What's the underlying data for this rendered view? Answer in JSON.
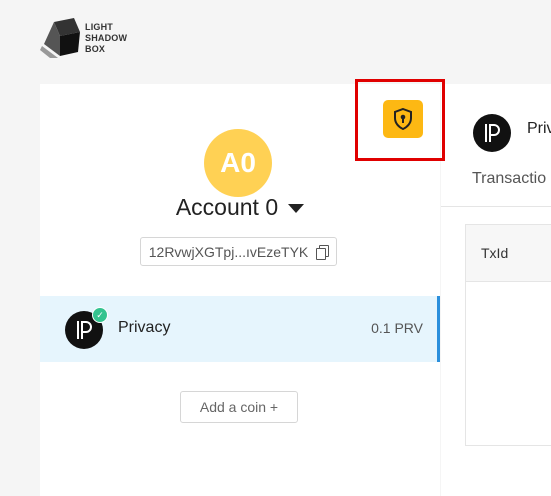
{
  "logo": {
    "line1": "LIGHT",
    "line2": "SHADOW",
    "line3": "BOX"
  },
  "account": {
    "avatar_initials": "A0",
    "name": "Account 0",
    "address": "12RvwjXGTpj...ıvEzeTYK"
  },
  "coins": [
    {
      "icon_text": "P",
      "name": "Privacy",
      "balance": "0.1 PRV",
      "selected": true
    }
  ],
  "add_coin_label": "Add a coin +",
  "right_panel": {
    "title": "Priv",
    "subtitle": "Transactio",
    "table_header": "TxId"
  },
  "colors": {
    "avatar": "#ffd154",
    "shield_button": "#fdb813",
    "selected_row": "#e6f5fd",
    "selected_border": "#2b8fdc",
    "highlight_box": "#e00000",
    "check_badge": "#34c38f"
  },
  "icons": {
    "logo": "cube-logo-icon",
    "shield": "shield-lock-icon",
    "copy": "copy-icon",
    "caret": "caret-down-icon",
    "coin": "privacy-coin-icon",
    "check": "check-icon"
  }
}
